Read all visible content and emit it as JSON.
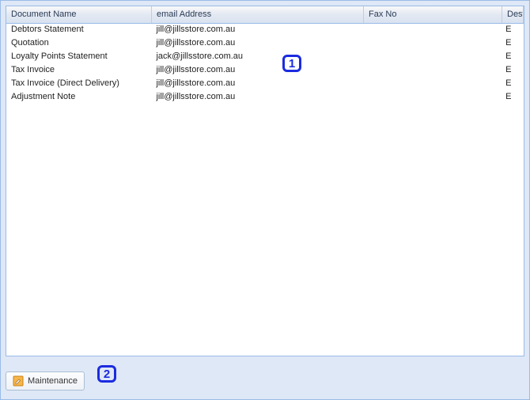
{
  "columns": {
    "document_name": "Document Name",
    "email": "email Address",
    "fax": "Fax No",
    "dest": "Dest"
  },
  "rows": [
    {
      "doc": "Debtors Statement",
      "email": "jill@jillsstore.com.au",
      "fax": "",
      "dest": "E"
    },
    {
      "doc": "Quotation",
      "email": "jill@jillsstore.com.au",
      "fax": "",
      "dest": "E"
    },
    {
      "doc": "Loyalty Points Statement",
      "email": "jack@jillsstore.com.au",
      "fax": "",
      "dest": "E"
    },
    {
      "doc": "Tax Invoice",
      "email": "jill@jillsstore.com.au",
      "fax": "",
      "dest": "E"
    },
    {
      "doc": "Tax Invoice (Direct Delivery)",
      "email": "jill@jillsstore.com.au",
      "fax": "",
      "dest": "E"
    },
    {
      "doc": "Adjustment Note",
      "email": "jill@jillsstore.com.au",
      "fax": "",
      "dest": "E"
    }
  ],
  "toolbar": {
    "maintenance_label": "Maintenance"
  },
  "callouts": {
    "one": "1",
    "two": "2"
  }
}
